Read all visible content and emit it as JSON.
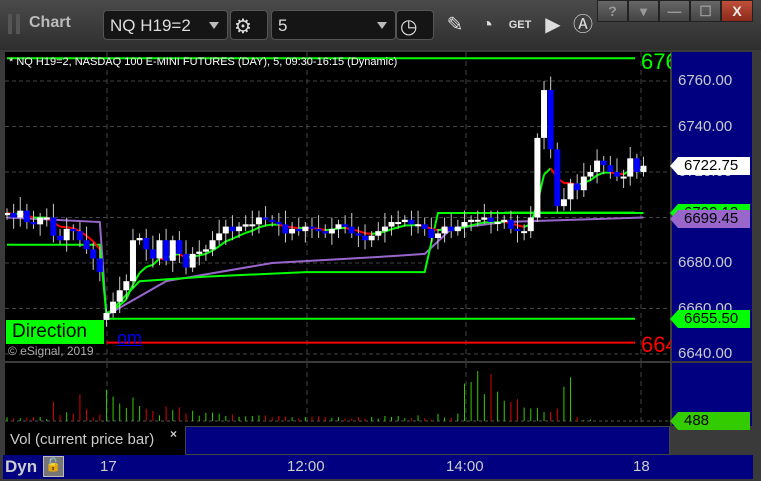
{
  "window": {
    "title": "Chart",
    "symbol": "NQ H19=2",
    "interval": "5",
    "controls": {
      "help": "?",
      "menu": "▾",
      "minimize": "—",
      "maximize": "☐",
      "close": "X"
    }
  },
  "toolbar_icons": [
    "gear-icon",
    "clock-icon",
    "pencil-icon",
    "study-icon",
    "get-icon",
    "play-icon",
    "alert-icon"
  ],
  "chart_header": "* NQ H19=2, NASDAQ 100 E-MINI FUTURES (DAY), 5, 09:30-16:15 (Dynamic)",
  "overlay": {
    "direction_label": "Direction",
    "link_fragment": "om",
    "copyright": "© eSignal, 2019",
    "top_level_label": "676",
    "bottom_level_label": "664"
  },
  "vol_pane": {
    "label": "Vol (current price bar)",
    "close": "×",
    "last_value": "488"
  },
  "bottom": {
    "dyn": "Dyn",
    "time_ticks": [
      "17",
      "12:00",
      "14:00",
      "18"
    ]
  },
  "colors": {
    "up": "#ffffff",
    "down": "#0000ff",
    "ma_up": "#00ff00",
    "ma_down": "#ff0000",
    "vwap": "#9966cc",
    "axis_bg": "#000080"
  },
  "chart_data": {
    "type": "candlestick",
    "yticks": [
      "6760.00",
      "6740.00",
      "6720.00",
      "6680.00",
      "6660.00",
      "6640.00"
    ],
    "ytick_values": [
      6760,
      6740,
      6720,
      6680,
      6660,
      6640
    ],
    "ylim": [
      6636,
      6772
    ],
    "price_flags": [
      {
        "label": "6722.75",
        "value": 6722.75,
        "color": "#ffffff"
      },
      {
        "label": "6702.13",
        "value": 6702.13,
        "color": "#00ff00"
      },
      {
        "label": "6699.45",
        "value": 6699.45,
        "color": "#9966cc"
      },
      {
        "label": "6655.50",
        "value": 6655.5,
        "color": "#00ff00"
      }
    ],
    "levels": [
      {
        "value": 6770,
        "color": "#00ff00",
        "from": 0
      },
      {
        "value": 6655.5,
        "color": "#00ff00",
        "from": 15
      },
      {
        "value": 6645,
        "color": "#ff0000",
        "from": 15
      },
      {
        "value": 6702.13,
        "color": "#00ff00",
        "from": 75
      }
    ],
    "prior_closes": [
      6702,
      6700,
      6703,
      6698,
      6697,
      6700,
      6700,
      6692,
      6690,
      6695,
      6694,
      6690,
      6686,
      6682,
      6676
    ],
    "closes": [
      6658,
      6663,
      6668,
      6672,
      6690,
      6691,
      6686,
      6682,
      6690,
      6681,
      6690,
      6684,
      6678,
      6684,
      6685,
      6686,
      6690,
      6693,
      6696,
      6694,
      6696,
      6697,
      6697,
      6700,
      6699,
      6698,
      6697,
      6693,
      6695,
      6694,
      6696,
      6695,
      6694,
      6693,
      6695,
      6697,
      6696,
      6693,
      6692,
      6690,
      6692,
      6694,
      6696,
      6698,
      6698,
      6699,
      6697,
      6697,
      6695,
      6691,
      6693,
      6696,
      6694,
      6696,
      6698,
      6699,
      6699,
      6700,
      6698,
      6698,
      6699,
      6695,
      6694,
      6694,
      6700,
      6735,
      6756,
      6730,
      6705,
      6708,
      6715,
      6712,
      6718,
      6720,
      6725,
      6723,
      6720,
      6718,
      6718,
      6726,
      6720,
      6722.75
    ],
    "vwap": [
      [
        0,
        6700
      ],
      [
        14,
        6698
      ],
      [
        15,
        6657
      ],
      [
        24,
        6672
      ],
      [
        40,
        6680
      ],
      [
        58,
        6683
      ],
      [
        63,
        6684
      ],
      [
        67,
        6695
      ],
      [
        75,
        6698
      ],
      [
        96,
        6700
      ]
    ],
    "support_step": [
      [
        0,
        6688
      ],
      [
        14,
        6688
      ],
      [
        15,
        6657
      ],
      [
        20,
        6672
      ],
      [
        30,
        6674
      ],
      [
        45,
        6676
      ],
      [
        63,
        6676
      ],
      [
        65,
        6702
      ],
      [
        96,
        6702
      ]
    ],
    "volumes": [
      1200,
      900,
      900,
      1100,
      1300,
      1300,
      600,
      6200,
      1900,
      2800,
      2300,
      8500,
      3800,
      1200,
      2100,
      10000,
      7800,
      5600,
      4200,
      7500,
      4800,
      3900,
      3200,
      1800,
      4600,
      3500,
      4400,
      2400,
      3300,
      1700,
      2600,
      2700,
      2300,
      1600,
      2100,
      1300,
      1500,
      1600,
      1800,
      1800,
      1200,
      1600,
      1400,
      1200,
      900,
      1300,
      1400,
      1500,
      1300,
      1000,
      1200,
      800,
      800,
      1300,
      700,
      1300,
      800,
      1600,
      1300,
      1600,
      900,
      900,
      1800,
      900,
      400,
      2300,
      1100,
      1000,
      2400,
      12000,
      12500,
      16000,
      8600,
      15000,
      9400,
      6500,
      6100,
      7000,
      4300,
      4000,
      4200,
      2900,
      2900,
      4000,
      11000,
      14000,
      1300,
      300,
      488
    ]
  }
}
